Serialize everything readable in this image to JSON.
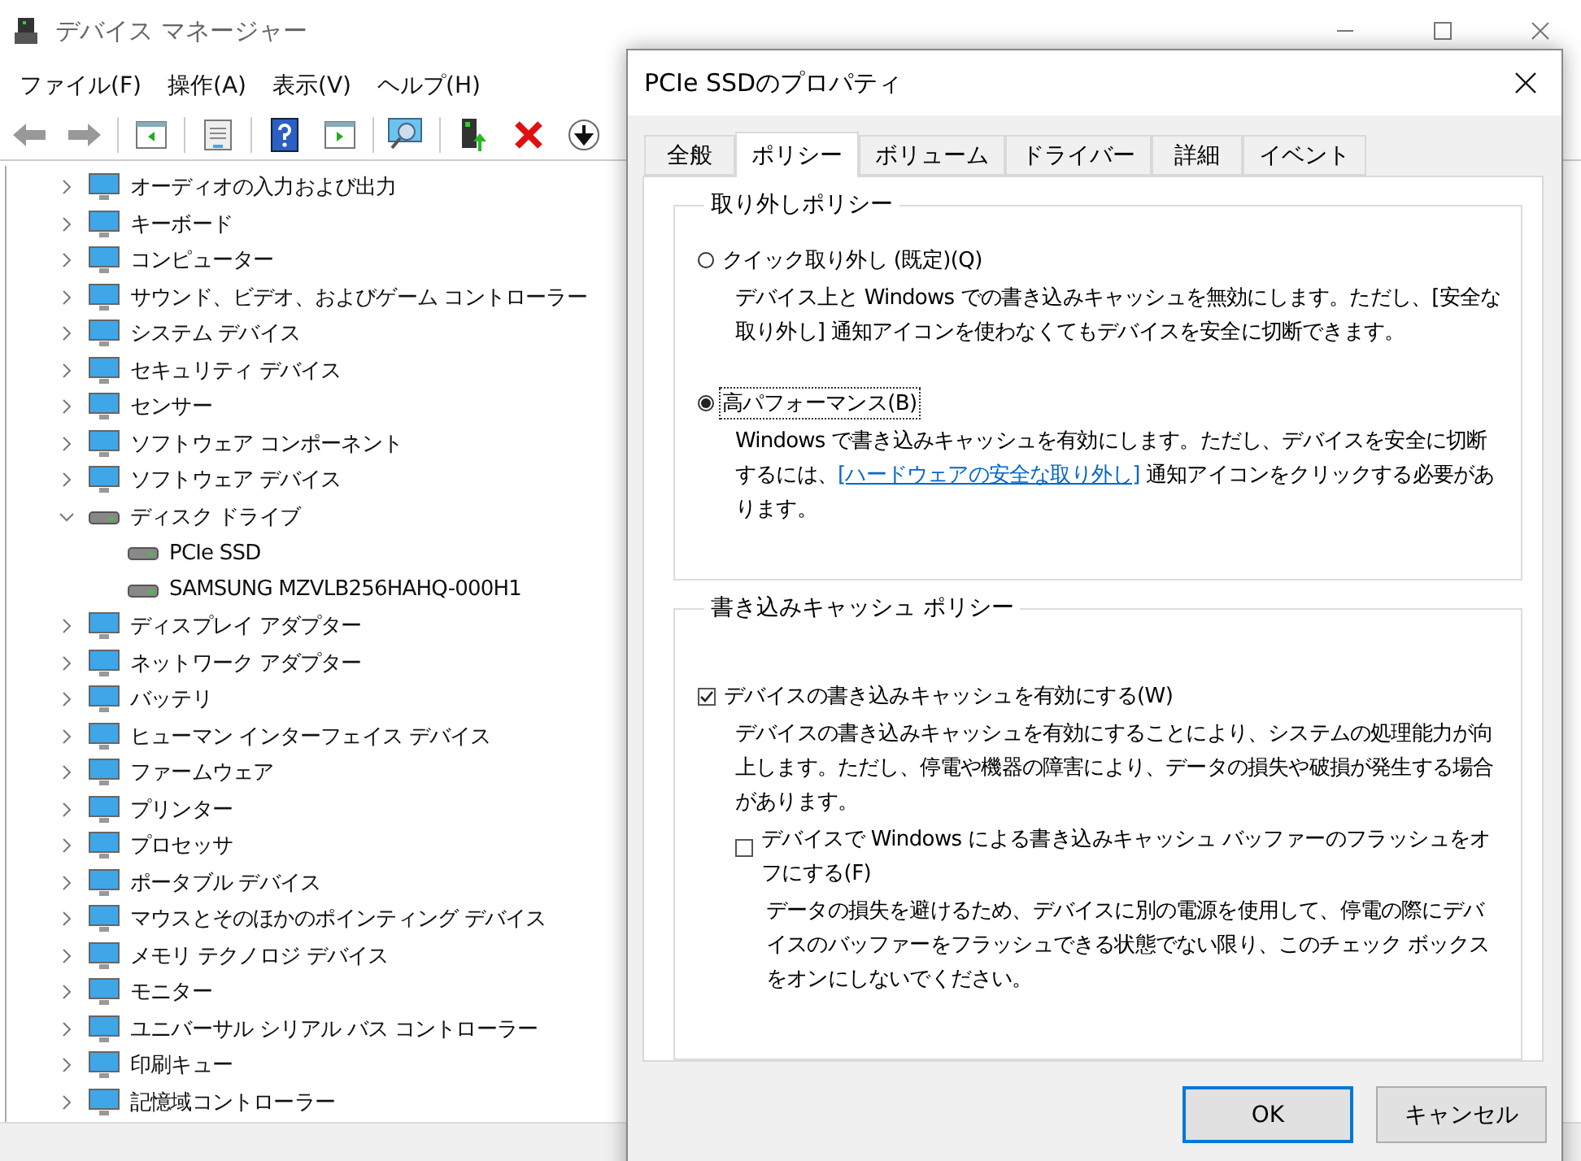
{
  "main_window": {
    "title": "デバイス マネージャー",
    "menu": [
      "ファイル(F)",
      "操作(A)",
      "表示(V)",
      "ヘルプ(H)"
    ],
    "tree": [
      {
        "label": "オーディオの入力および出力",
        "expanded": false
      },
      {
        "label": "キーボード",
        "expanded": false
      },
      {
        "label": "コンピューター",
        "expanded": false
      },
      {
        "label": "サウンド、ビデオ、およびゲーム コントローラー",
        "expanded": false
      },
      {
        "label": "システム デバイス",
        "expanded": false
      },
      {
        "label": "セキュリティ デバイス",
        "expanded": false
      },
      {
        "label": "センサー",
        "expanded": false
      },
      {
        "label": "ソフトウェア コンポーネント",
        "expanded": false
      },
      {
        "label": "ソフトウェア デバイス",
        "expanded": false
      },
      {
        "label": "ディスク ドライブ",
        "expanded": true,
        "children": [
          {
            "label": "PCIe SSD"
          },
          {
            "label": "SAMSUNG MZVLB256HAHQ-000H1"
          }
        ]
      },
      {
        "label": "ディスプレイ アダプター",
        "expanded": false
      },
      {
        "label": "ネットワーク アダプター",
        "expanded": false
      },
      {
        "label": "バッテリ",
        "expanded": false
      },
      {
        "label": "ヒューマン インターフェイス デバイス",
        "expanded": false
      },
      {
        "label": "ファームウェア",
        "expanded": false
      },
      {
        "label": "プリンター",
        "expanded": false
      },
      {
        "label": "プロセッサ",
        "expanded": false
      },
      {
        "label": "ポータブル デバイス",
        "expanded": false
      },
      {
        "label": "マウスとそのほかのポインティング デバイス",
        "expanded": false
      },
      {
        "label": "メモリ テクノロジ デバイス",
        "expanded": false
      },
      {
        "label": "モニター",
        "expanded": false
      },
      {
        "label": "ユニバーサル シリアル バス コントローラー",
        "expanded": false
      },
      {
        "label": "印刷キュー",
        "expanded": false
      },
      {
        "label": "記憶域コントローラー",
        "expanded": false
      }
    ]
  },
  "dialog": {
    "title": "PCIe SSDのプロパティ",
    "tabs": [
      {
        "label": "全般",
        "selected": false
      },
      {
        "label": "ポリシー",
        "selected": true
      },
      {
        "label": "ボリューム",
        "selected": false
      },
      {
        "label": "ドライバー",
        "selected": false
      },
      {
        "label": "詳細",
        "selected": false
      },
      {
        "label": "イベント",
        "selected": false
      }
    ],
    "removal_policy": {
      "heading": "取り外しポリシー",
      "options": [
        {
          "label": "クイック取り外し (既定)(Q)",
          "selected": false,
          "description": [
            {
              "kind": "text",
              "text": "デバイス上と Windows での書き込みキャッシュを無効にします。ただし、[安全な取り外し] 通知アイコンを使わなくてもデバイスを安全に切断できます。"
            }
          ]
        },
        {
          "label": "高パフォーマンス(B)",
          "selected": true,
          "description": [
            {
              "kind": "text",
              "text": "Windows で書き込みキャッシュを有効にします。ただし、デバイスを安全に切断するには、"
            },
            {
              "kind": "link",
              "text": "[ハードウェアの安全な取り外し]"
            },
            {
              "kind": "text",
              "text": " 通知アイコンをクリックする必要があります。"
            }
          ]
        }
      ]
    },
    "write_cache": {
      "heading": "書き込みキャッシュ ポリシー",
      "enable": {
        "label": "デバイスの書き込みキャッシュを有効にする(W)",
        "checked": true,
        "description": "デバイスの書き込みキャッシュを有効にすることにより、システムの処理能力が向上します。ただし、停電や機器の障害により、データの損失や破損が発生する場合があります。"
      },
      "disable_flush": {
        "label": "デバイスで Windows による書き込みキャッシュ バッファーのフラッシュをオフにする(F)",
        "checked": false,
        "description": "データの損失を避けるため、デバイスに別の電源を使用して、停電の際にデバイスのバッファーをフラッシュできる状態でない限り、このチェック ボックスをオンにしないでください。"
      }
    },
    "buttons": [
      {
        "label": "OK",
        "default": true
      },
      {
        "label": "キャンセル",
        "default": false
      }
    ]
  }
}
